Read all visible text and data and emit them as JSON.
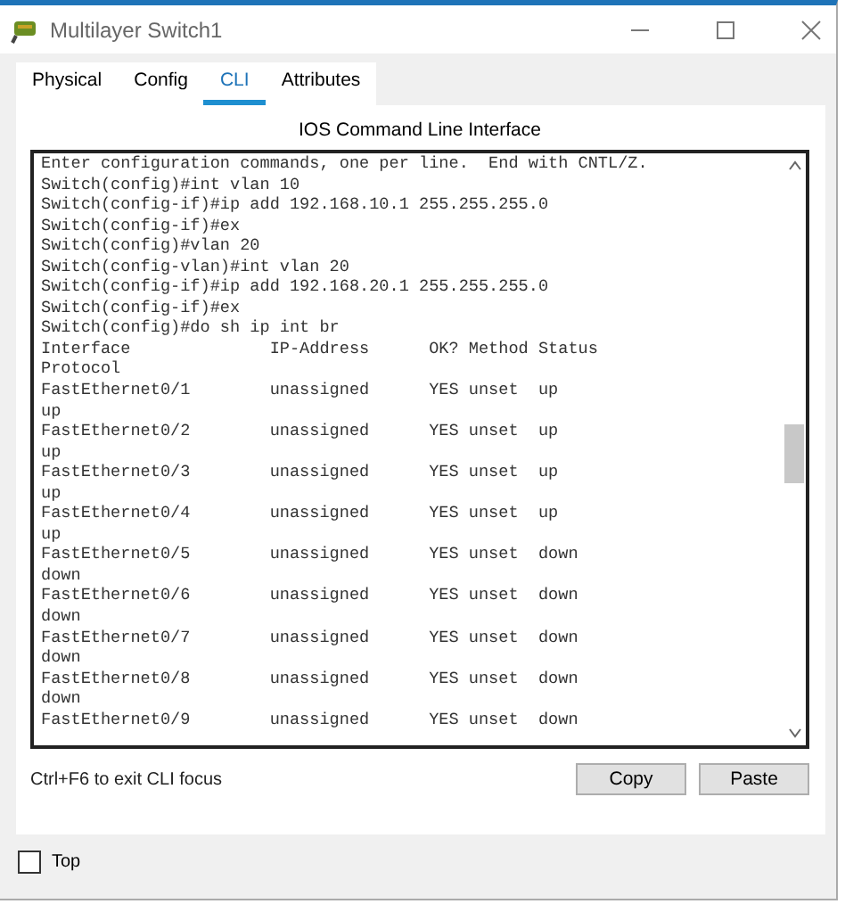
{
  "window": {
    "title": "Multilayer Switch1"
  },
  "tabs": [
    {
      "label": "Physical",
      "selected": false
    },
    {
      "label": "Config",
      "selected": false
    },
    {
      "label": "CLI",
      "selected": true
    },
    {
      "label": "Attributes",
      "selected": false
    }
  ],
  "panel_title": "IOS Command Line Interface",
  "terminal": {
    "lines": [
      "Enter configuration commands, one per line.  End with CNTL/Z.",
      "Switch(config)#int vlan 10",
      "Switch(config-if)#ip add 192.168.10.1 255.255.255.0",
      "Switch(config-if)#ex",
      "Switch(config)#vlan 20",
      "Switch(config-vlan)#int vlan 20",
      "Switch(config-if)#ip add 192.168.20.1 255.255.255.0",
      "Switch(config-if)#ex",
      "Switch(config)#do sh ip int br",
      "Interface              IP-Address      OK? Method Status",
      "Protocol",
      "FastEthernet0/1        unassigned      YES unset  up",
      "up",
      "FastEthernet0/2        unassigned      YES unset  up",
      "up",
      "FastEthernet0/3        unassigned      YES unset  up",
      "up",
      "FastEthernet0/4        unassigned      YES unset  up",
      "up",
      "FastEthernet0/5        unassigned      YES unset  down",
      "down",
      "FastEthernet0/6        unassigned      YES unset  down",
      "down",
      "FastEthernet0/7        unassigned      YES unset  down",
      "down",
      "FastEthernet0/8        unassigned      YES unset  down",
      "down",
      "FastEthernet0/9        unassigned      YES unset  down"
    ]
  },
  "hint": "Ctrl+F6 to exit CLI focus",
  "buttons": [
    "Copy",
    "Paste"
  ],
  "top_checkbox": {
    "label": "Top",
    "checked": false
  }
}
